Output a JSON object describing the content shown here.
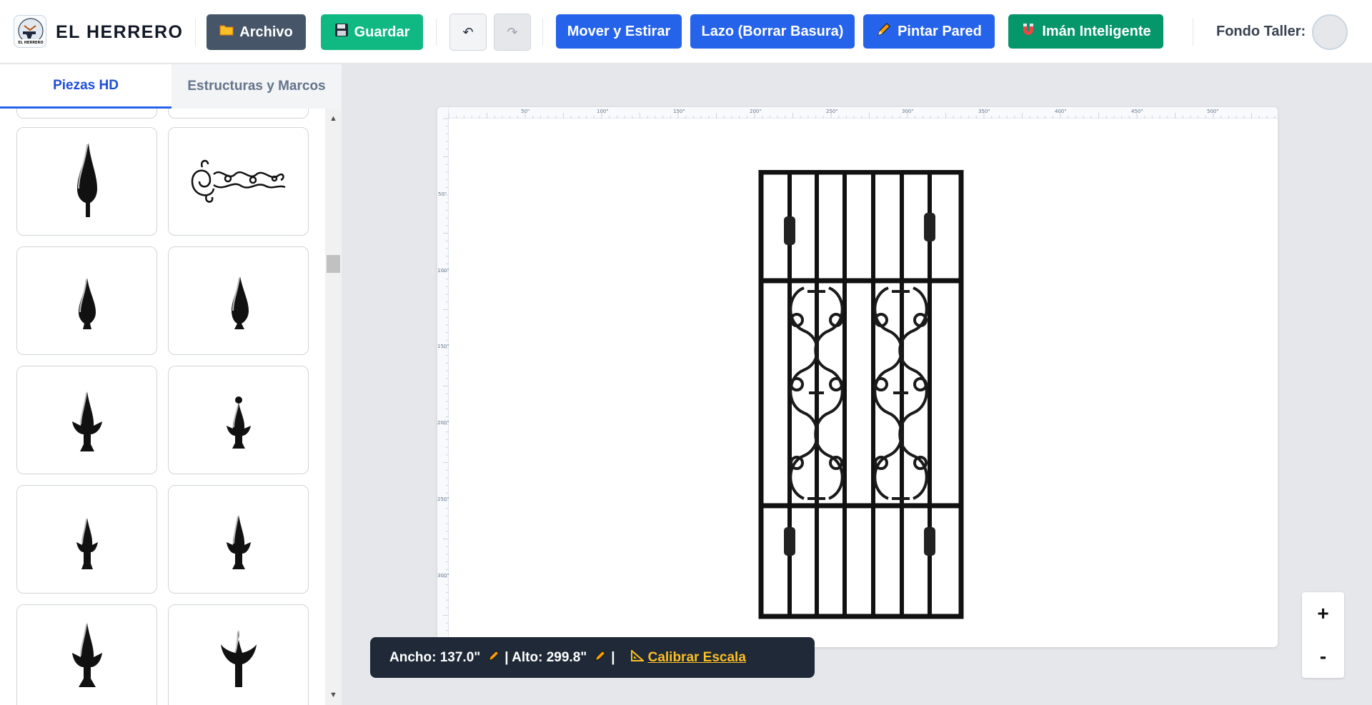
{
  "app": {
    "brand": "EL HERRERO",
    "logo_text": "EL HERRERO"
  },
  "toolbar": {
    "archivo_label": "Archivo",
    "guardar_label": "Guardar",
    "undo_icon": "undo-icon",
    "redo_icon": "redo-icon",
    "tools": [
      {
        "label": "Mover y Estirar"
      },
      {
        "label": "Lazo (Borrar Basura)"
      },
      {
        "label": "Pintar Pared"
      },
      {
        "label": "Imán Inteligente"
      }
    ],
    "background_label": "Fondo Taller:",
    "colors": {
      "dark": "#475569",
      "green": "#10b981",
      "blue": "#2563eb",
      "teal": "#059669"
    }
  },
  "sidebar": {
    "tabs": [
      {
        "label": "Piezas HD",
        "active": true
      },
      {
        "label": "Estructuras y Marcos",
        "active": false
      }
    ],
    "pieces": [
      {
        "name": "spear-point-tall"
      },
      {
        "name": "scroll-ornament"
      },
      {
        "name": "spear-point-plain"
      },
      {
        "name": "spear-point-plain-alt"
      },
      {
        "name": "fleur-spear"
      },
      {
        "name": "fleur-spear-ball"
      },
      {
        "name": "fleur-spear-small"
      },
      {
        "name": "fleur-spear-medium"
      },
      {
        "name": "fleur-spear-large"
      },
      {
        "name": "fleur-spear-curved"
      }
    ]
  },
  "canvas": {
    "ruler_top": [
      "50\"",
      "100\"",
      "150\"",
      "200\"",
      "250\"",
      "300\"",
      "350\"",
      "400\"",
      "450\"",
      "500\""
    ],
    "ruler_left": [
      "50\"",
      "100\"",
      "150\"",
      "200\"",
      "250\"",
      "300\""
    ]
  },
  "measure": {
    "width_text": "Ancho: 137.0\"",
    "height_text": "| Alto: 299.8\"",
    "separator": "|",
    "calibrate_label": "Calibrar Escala"
  },
  "zoom": {
    "in": "+",
    "out": "-"
  }
}
